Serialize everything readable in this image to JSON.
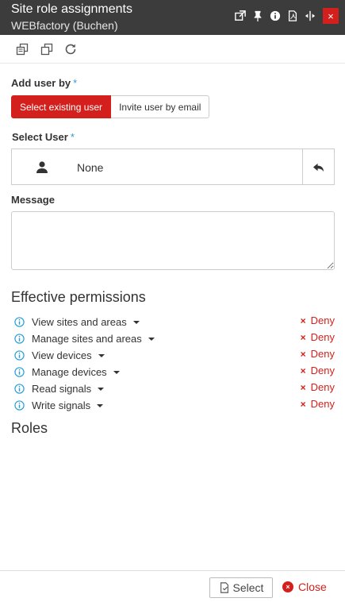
{
  "window": {
    "title": "Site role assignments",
    "subtitle": "WEBfactory (Buchen)",
    "close_glyph": "×",
    "icons": [
      "popout-icon",
      "pin-icon",
      "info-icon",
      "pdf-icon",
      "resize-icon",
      "close-icon"
    ]
  },
  "toolbar": {
    "icons": [
      "copy-icon",
      "clone-icon",
      "refresh-icon"
    ]
  },
  "add_user": {
    "label": "Add user by",
    "required_mark": "*",
    "options": [
      "Select existing user",
      "Invite user by email"
    ],
    "selected": "Select existing user"
  },
  "select_user": {
    "label": "Select User",
    "required_mark": "*",
    "value": "None"
  },
  "message": {
    "label": "Message",
    "value": ""
  },
  "effective_permissions": {
    "title": "Effective permissions",
    "items": [
      {
        "name": "View sites and areas",
        "status": "Deny"
      },
      {
        "name": "Manage sites and areas",
        "status": "Deny"
      },
      {
        "name": "View devices",
        "status": "Deny"
      },
      {
        "name": "Manage devices",
        "status": "Deny"
      },
      {
        "name": "Read signals",
        "status": "Deny"
      },
      {
        "name": "Write signals",
        "status": "Deny"
      }
    ],
    "deny_glyph": "×"
  },
  "roles": {
    "title": "Roles"
  },
  "footer": {
    "select_label": "Select",
    "close_label": "Close",
    "close_glyph": "×"
  },
  "colors": {
    "accent": "#d4201c",
    "titlebar": "#3c3c3c",
    "info": "#2a9fd6"
  }
}
